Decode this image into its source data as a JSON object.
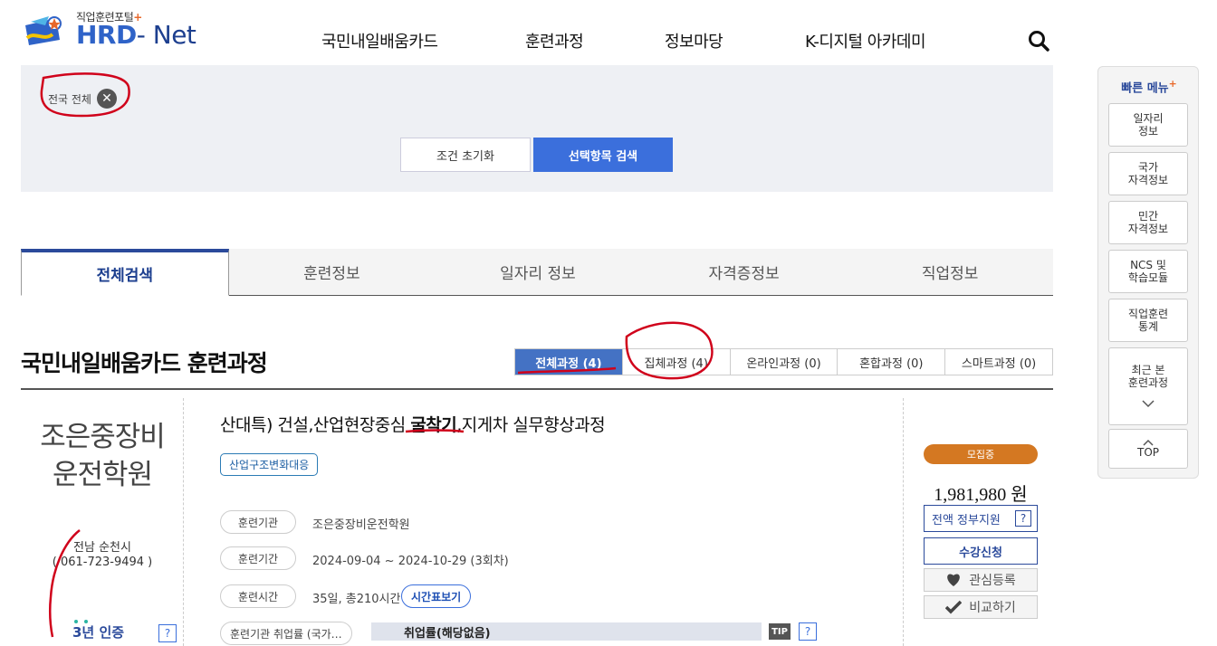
{
  "header": {
    "logo_subtitle": "직업훈련포털",
    "logo_plus": "+",
    "logo_hrd": "HRD",
    "logo_dash_net": "- Net",
    "nav": [
      "국민내일배움카드",
      "훈련과정",
      "정보마당",
      "K-디지털 아카데미"
    ]
  },
  "filter": {
    "chip_label": "전국 전체",
    "reset_label": "조건 초기화",
    "search_label": "선택항목 검색"
  },
  "main_tabs": [
    "전체검색",
    "훈련정보",
    "일자리 정보",
    "자격증정보",
    "직업정보"
  ],
  "section": {
    "title": "국민내일배움카드 훈련과정",
    "subtabs": [
      "전체과정 (4)",
      "집체과정 (4)",
      "온라인과정 (0)",
      "혼합과정 (0)",
      "스마트과정 (0)"
    ]
  },
  "result": {
    "org_name_line1": "조은중장비",
    "org_name_line2": "운전학원",
    "location": "전남 순천시",
    "phone": "( 061-723-9494 )",
    "cert_years": "3년",
    "cert_label": "인증",
    "q_mark": "?",
    "title_pre": "산대특) 건설,산업현장중심 ",
    "title_bold": "굴착기",
    "title_post": ",지게차 실무향상과정",
    "tag": "산업구조변화대응",
    "info": [
      {
        "label": "훈련기관",
        "value": "조은중장비운전학원"
      },
      {
        "label": "훈련기간",
        "value": "2024-09-04 ~ 2024-10-29 (3회차)"
      },
      {
        "label": "훈련시간",
        "value": "35일, 총210시간"
      }
    ],
    "timetable_label": "시간표보기",
    "employment_label": "훈련기관 취업률 (국가…",
    "employment_value": "취업률(해당없음)",
    "tip_label": "TIP",
    "status": "모집중",
    "price": "1,981,980 원",
    "support": "전액 정부지원",
    "apply": "수강신청",
    "wishlist": "관심등록",
    "compare": "비교하기"
  },
  "quick_menu": {
    "title": "빠른 메뉴",
    "plus": "+",
    "items": [
      [
        "일자리",
        "정보"
      ],
      [
        "국가",
        "자격정보"
      ],
      [
        "민간",
        "자격정보"
      ],
      [
        "NCS 및",
        "학습모듈"
      ],
      [
        "직업훈련",
        "통계"
      ],
      [
        "최근 본",
        "훈련과정"
      ]
    ],
    "top_label": "TOP"
  },
  "colors": {
    "brand_blue": "#2b4a9b",
    "accent_blue": "#3b6fdc",
    "status_orange": "#d47822",
    "annotation_red": "#d0021b"
  }
}
